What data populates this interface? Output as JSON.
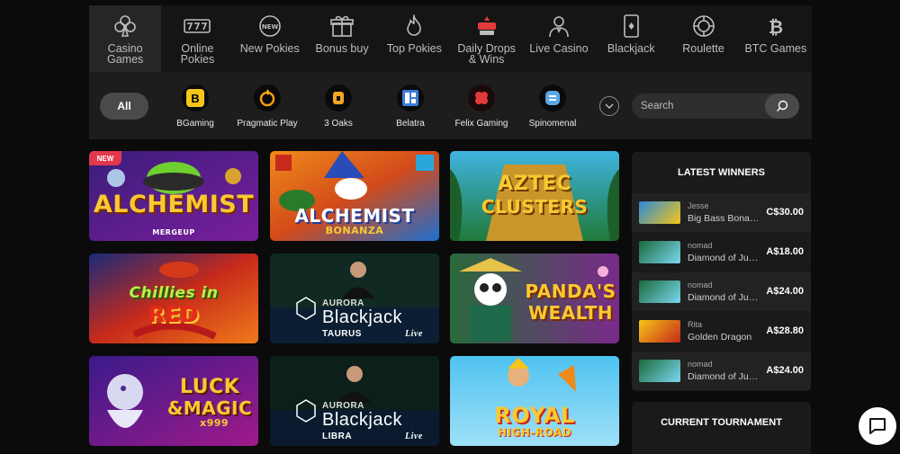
{
  "categories": [
    {
      "label": "Casino Games",
      "icon": "clubs-icon",
      "active": true
    },
    {
      "label": "Online Pokies",
      "icon": "slot-777-icon",
      "active": false
    },
    {
      "label": "New Pokies",
      "icon": "new-badge-icon",
      "active": false
    },
    {
      "label": "Bonus buy",
      "icon": "gift-icon",
      "active": false
    },
    {
      "label": "Top Pokies",
      "icon": "flame-icon",
      "active": false
    },
    {
      "label": "Daily Drops & Wins",
      "icon": "drops-wins-icon",
      "active": false
    },
    {
      "label": "Live Casino",
      "icon": "dealer-icon",
      "active": false
    },
    {
      "label": "Blackjack",
      "icon": "playing-card-icon",
      "active": false
    },
    {
      "label": "Roulette",
      "icon": "roulette-icon",
      "active": false
    },
    {
      "label": "BTC Games",
      "icon": "bitcoin-icon",
      "active": false
    }
  ],
  "filters": {
    "all_label": "All",
    "providers": [
      {
        "name": "BGaming",
        "logo_text": "B",
        "color": "#f5c518"
      },
      {
        "name": "Pragmatic Play",
        "logo_text": "",
        "color": "#f39c12"
      },
      {
        "name": "3 Oaks",
        "logo_text": "",
        "color": "#f5a623"
      },
      {
        "name": "Belatra",
        "logo_text": "",
        "color": "#3b7bd8"
      },
      {
        "name": "Felix Gaming",
        "logo_text": "",
        "color": "#e23a3a"
      },
      {
        "name": "Spinomenal",
        "logo_text": "",
        "color": "#5aa9e6"
      }
    ],
    "search_placeholder": "Search"
  },
  "games": [
    {
      "title": "ALCHEMIST",
      "subtitle": "MERGEUP",
      "badge": "NEW"
    },
    {
      "title": "ALCHEMIST",
      "subtitle": "BONANZA",
      "badge": ""
    },
    {
      "title": "AZTEC",
      "subtitle": "CLUSTERS",
      "badge": ""
    },
    {
      "title": "Chillies in",
      "subtitle": "RED",
      "badge": ""
    },
    {
      "title": "Blackjack",
      "overline": "AURORA",
      "subtitle": "TAURUS",
      "tag": "Live",
      "badge": ""
    },
    {
      "title": "PANDA'S",
      "subtitle": "WEALTH",
      "badge": ""
    },
    {
      "title": "LUCK",
      "overline": "&MAGIC",
      "subtitle": "x999",
      "badge": ""
    },
    {
      "title": "Blackjack",
      "overline": "AURORA",
      "subtitle": "LIBRA",
      "tag": "Live",
      "badge": ""
    },
    {
      "title": "ROYAL",
      "subtitle": "HIGH-ROAD",
      "badge": ""
    }
  ],
  "winners": {
    "title": "LATEST WINNERS",
    "rows": [
      {
        "user": "Jesse",
        "game": "Big Bass Bonanza",
        "amount": "C$30.00"
      },
      {
        "user": "nomad",
        "game": "Diamond of Jungle",
        "amount": "A$18.00"
      },
      {
        "user": "nomad",
        "game": "Diamond of Jungle",
        "amount": "A$24.00"
      },
      {
        "user": "Rita",
        "game": "Golden Dragon",
        "amount": "A$28.80"
      },
      {
        "user": "nomad",
        "game": "Diamond of Jungle",
        "amount": "A$24.00"
      }
    ]
  },
  "tournament": {
    "title": "CURRENT TOURNAMENT"
  }
}
